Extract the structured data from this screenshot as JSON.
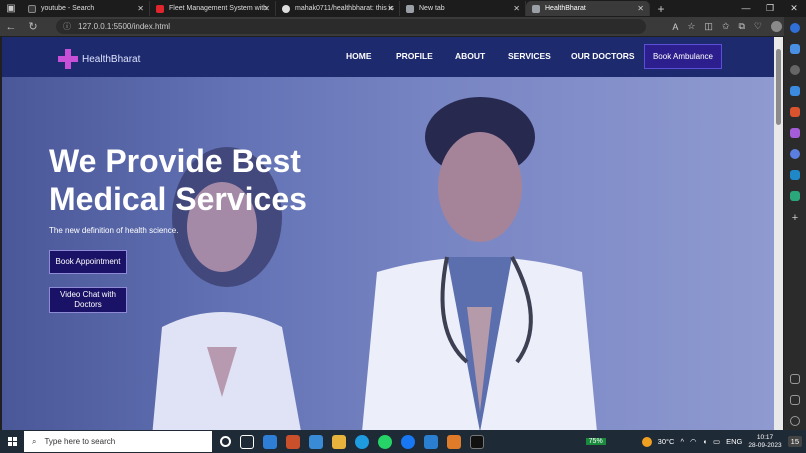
{
  "browser": {
    "tabs": [
      {
        "title": "youtube - Search",
        "color": "#3a3a3a"
      },
      {
        "title": "Fleet Management System with",
        "color": "#e0252c"
      },
      {
        "title": "mahak0711/healthbharat: this is",
        "color": "#dddddd"
      },
      {
        "title": "New tab",
        "color": "#9aa0a6"
      },
      {
        "title": "HealthBharat",
        "color": "#9aa0a6"
      }
    ],
    "url": "127.0.0.1:5500/index.html"
  },
  "site": {
    "logo": "HealthBharat",
    "nav": [
      "HOME",
      "PROFILE",
      "ABOUT",
      "SERVICES",
      "OUR DOCTORS"
    ],
    "cta": "Book Ambulance",
    "hero_title": "We Provide Best Medical Services",
    "hero_sub": "The new definition of health science.",
    "btn1": "Book Appointment",
    "btn2": "Video Chat with Doctors"
  },
  "taskbar": {
    "search_placeholder": "Type here to search",
    "battery": "75%",
    "temp": "30°C",
    "lang": "ENG",
    "time": "10:17",
    "date": "28-09-2023",
    "notif": "15"
  },
  "colors": {
    "navbar": "#1d2a6e",
    "accent": "#c84fd8"
  }
}
